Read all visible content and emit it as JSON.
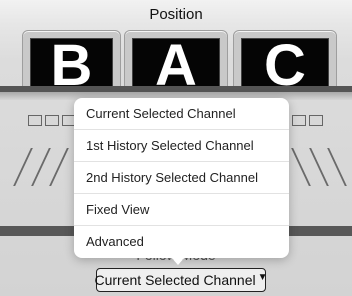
{
  "header": {
    "title": "Position"
  },
  "cameras": [
    {
      "label": "B"
    },
    {
      "label": "A"
    },
    {
      "label": "C"
    }
  ],
  "follow_mode": {
    "label": "Follow Mode",
    "selected": "Current Selected Channel"
  },
  "dropdown": {
    "options": [
      "Current Selected Channel",
      "1st History Selected Channel",
      "2nd History Selected Channel",
      "Fixed View",
      "Advanced"
    ]
  }
}
